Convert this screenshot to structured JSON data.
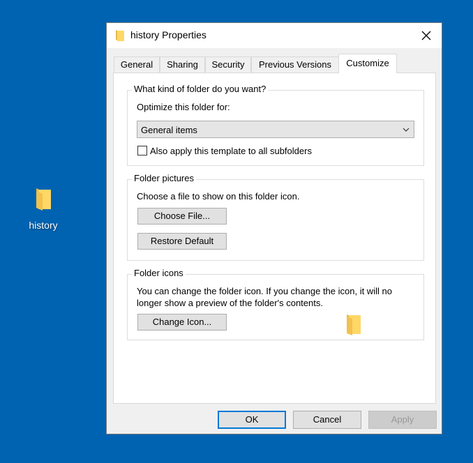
{
  "desktop": {
    "icon_label": "history"
  },
  "dialog": {
    "title": "history Properties",
    "tabs": [
      {
        "label": "General"
      },
      {
        "label": "Sharing"
      },
      {
        "label": "Security"
      },
      {
        "label": "Previous Versions"
      },
      {
        "label": "Customize",
        "active": true
      }
    ],
    "folder_type": {
      "group_title": "What kind of folder do you want?",
      "optimize_label": "Optimize this folder for:",
      "selected": "General items",
      "apply_subfolders_label": "Also apply this template to all subfolders",
      "apply_subfolders_checked": false
    },
    "folder_pictures": {
      "group_title": "Folder pictures",
      "description": "Choose a file to show on this folder icon.",
      "choose_file_label": "Choose File...",
      "restore_default_label": "Restore Default"
    },
    "folder_icons": {
      "group_title": "Folder icons",
      "description_line1": "You can change the folder icon. If you change the icon, it will no",
      "description_line2": "longer show a preview of the folder's contents.",
      "change_icon_label": "Change Icon..."
    },
    "buttons": {
      "ok": "OK",
      "cancel": "Cancel",
      "apply": "Apply"
    }
  },
  "colors": {
    "desktop": "#0063b1",
    "accent": "#0078d7",
    "folder": "#ffd766"
  }
}
